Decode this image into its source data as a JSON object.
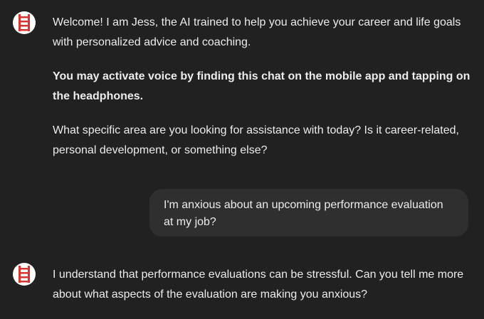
{
  "messages": [
    {
      "role": "assistant",
      "avatar_icon": "ladder-icon",
      "paragraphs": [
        "Welcome! I am Jess, the AI trained to help you achieve your career and life goals with personalized advice and coaching.",
        "You may activate voice by finding this chat on the mobile app and tapping on the headphones.",
        "What specific area are you looking for assistance with today? Is it career-related, personal development, or something else?"
      ]
    },
    {
      "role": "user",
      "text": "I'm anxious about an upcoming performance evaluation at my job?"
    },
    {
      "role": "assistant",
      "avatar_icon": "ladder-icon",
      "paragraphs": [
        "I understand that performance evaluations can be stressful. Can you tell me more about what aspects of the evaluation are making you anxious?"
      ]
    }
  ],
  "colors": {
    "background": "#212121",
    "user_bubble": "#2f2f2f",
    "text": "#ececec",
    "avatar_bg": "#ffffff",
    "ladder_red": "#d6362f"
  }
}
